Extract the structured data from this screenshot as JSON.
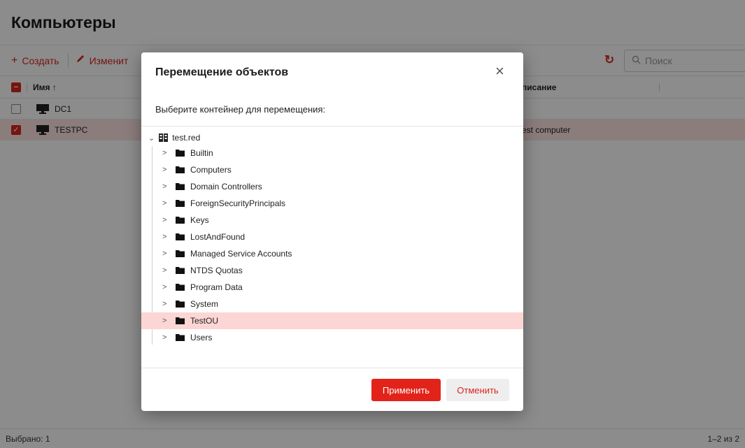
{
  "page": {
    "title": "Компьютеры",
    "toolbar": {
      "create_label": "Создать",
      "edit_label": "Изменит",
      "search_placeholder": "Поиск"
    },
    "table": {
      "col_name": "Имя",
      "col_description": "писание",
      "rows": [
        {
          "name": "DC1",
          "description": "",
          "checked": false
        },
        {
          "name": "TESTPC",
          "description": "est computer",
          "checked": true
        }
      ]
    },
    "status": {
      "selected": "Выбрано: 1",
      "range": "1–2 из 2"
    }
  },
  "modal": {
    "title": "Перемещение объектов",
    "subtitle": "Выберите контейнер для перемещения:",
    "tree": {
      "root": "test.red",
      "items": [
        {
          "label": "Builtin",
          "selected": false
        },
        {
          "label": "Computers",
          "selected": false
        },
        {
          "label": "Domain Controllers",
          "selected": false
        },
        {
          "label": "ForeignSecurityPrincipals",
          "selected": false
        },
        {
          "label": "Keys",
          "selected": false
        },
        {
          "label": "LostAndFound",
          "selected": false
        },
        {
          "label": "Managed Service Accounts",
          "selected": false
        },
        {
          "label": "NTDS Quotas",
          "selected": false
        },
        {
          "label": "Program Data",
          "selected": false
        },
        {
          "label": "System",
          "selected": false
        },
        {
          "label": "TestOU",
          "selected": true
        },
        {
          "label": "Users",
          "selected": false
        }
      ]
    },
    "apply_label": "Применить",
    "cancel_label": "Отменить"
  },
  "colors": {
    "accent": "#e2231a",
    "selection": "#fcd6d4"
  }
}
